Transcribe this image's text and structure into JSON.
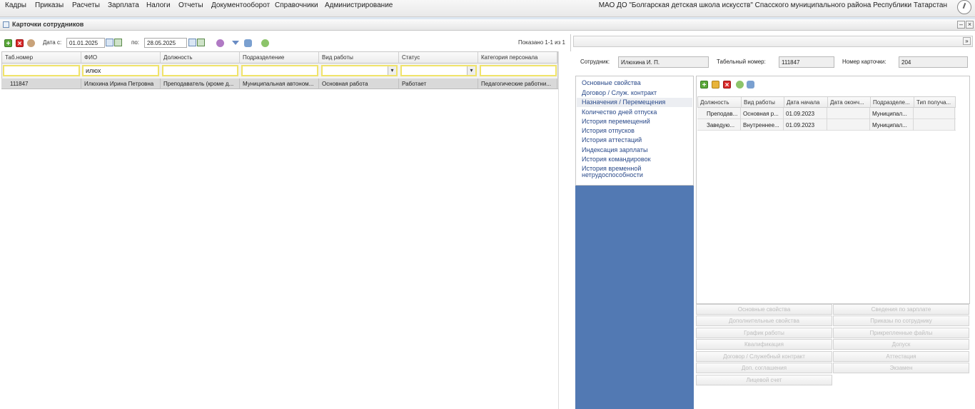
{
  "menu": [
    "Кадры",
    "Приказы",
    "Расчеты",
    "Зарплата",
    "Налоги",
    "Отчеты",
    "Документооборот",
    "Справочники",
    "Администрирование"
  ],
  "org_title": "МАО ДО \"Болгарская детская школа искусств\" Спасского муниципального района Республики Татарстан",
  "window_title": "Карточки сотрудников",
  "toolbar": {
    "date_from_label": "Дата с:",
    "date_from": "01.01.2025",
    "date_to_label": "по:",
    "date_to": "28.05.2025",
    "shown": "Показано 1-1 из 1"
  },
  "grid": {
    "columns": [
      "Таб.номер",
      "ФИО",
      "Должность",
      "Подразделение",
      "Вид работы",
      "Статус",
      "Категория персонала"
    ],
    "filters": [
      "",
      "илюх",
      "",
      "",
      "",
      "",
      ""
    ],
    "rows": [
      [
        "111847",
        "Илюхина Ирина Петровна",
        "Преподаватель (кроме д...",
        "Муниципальная автоном...",
        "Основная работа",
        "Работает",
        "Педагогические работни..."
      ]
    ]
  },
  "employee": {
    "employee_label": "Сотрудник:",
    "employee_value": "Илюхина И. П.",
    "tab_label": "Табельный номер:",
    "tab_value": "111847",
    "card_label": "Номер карточки:",
    "card_value": "204"
  },
  "nav": {
    "items": [
      "Основные свойства",
      "Договор / Служ. контракт",
      "Назначения / Перемещения",
      "Количество дней отпуска",
      "История перемещений",
      "История отпусков",
      "История аттестаций",
      "Индексация зарплаты",
      "История командировок",
      "История временной",
      "нетрудоспособности"
    ],
    "active_index": 2
  },
  "sub_grid": {
    "columns": [
      "Должность",
      "Вид работы",
      "Дата начала",
      "Дата оконч...",
      "Подразделе...",
      "Тип получа..."
    ],
    "rows": [
      [
        "Преподав...",
        "Основная р...",
        "01.09.2023",
        "",
        "Муниципал...",
        ""
      ],
      [
        "Заведую...",
        "Внутреннее...",
        "01.09.2023",
        "",
        "Муниципал...",
        ""
      ]
    ]
  },
  "buttons": [
    "Основные свойства",
    "Сведения по зарплате",
    "Дополнительные свойства",
    "Приказы по сотруднику",
    "График работы",
    "Прикрепленные файлы",
    "Квалификация",
    "Допуск",
    "Договор / Служебный контракт",
    "Аттестация",
    "Доп. соглашения",
    "Экзамен",
    "Лицевой счет"
  ],
  "colors": {
    "nav_fill": "#5279b3",
    "filter_border": "#f0e36a",
    "link": "#2a4a8a"
  }
}
